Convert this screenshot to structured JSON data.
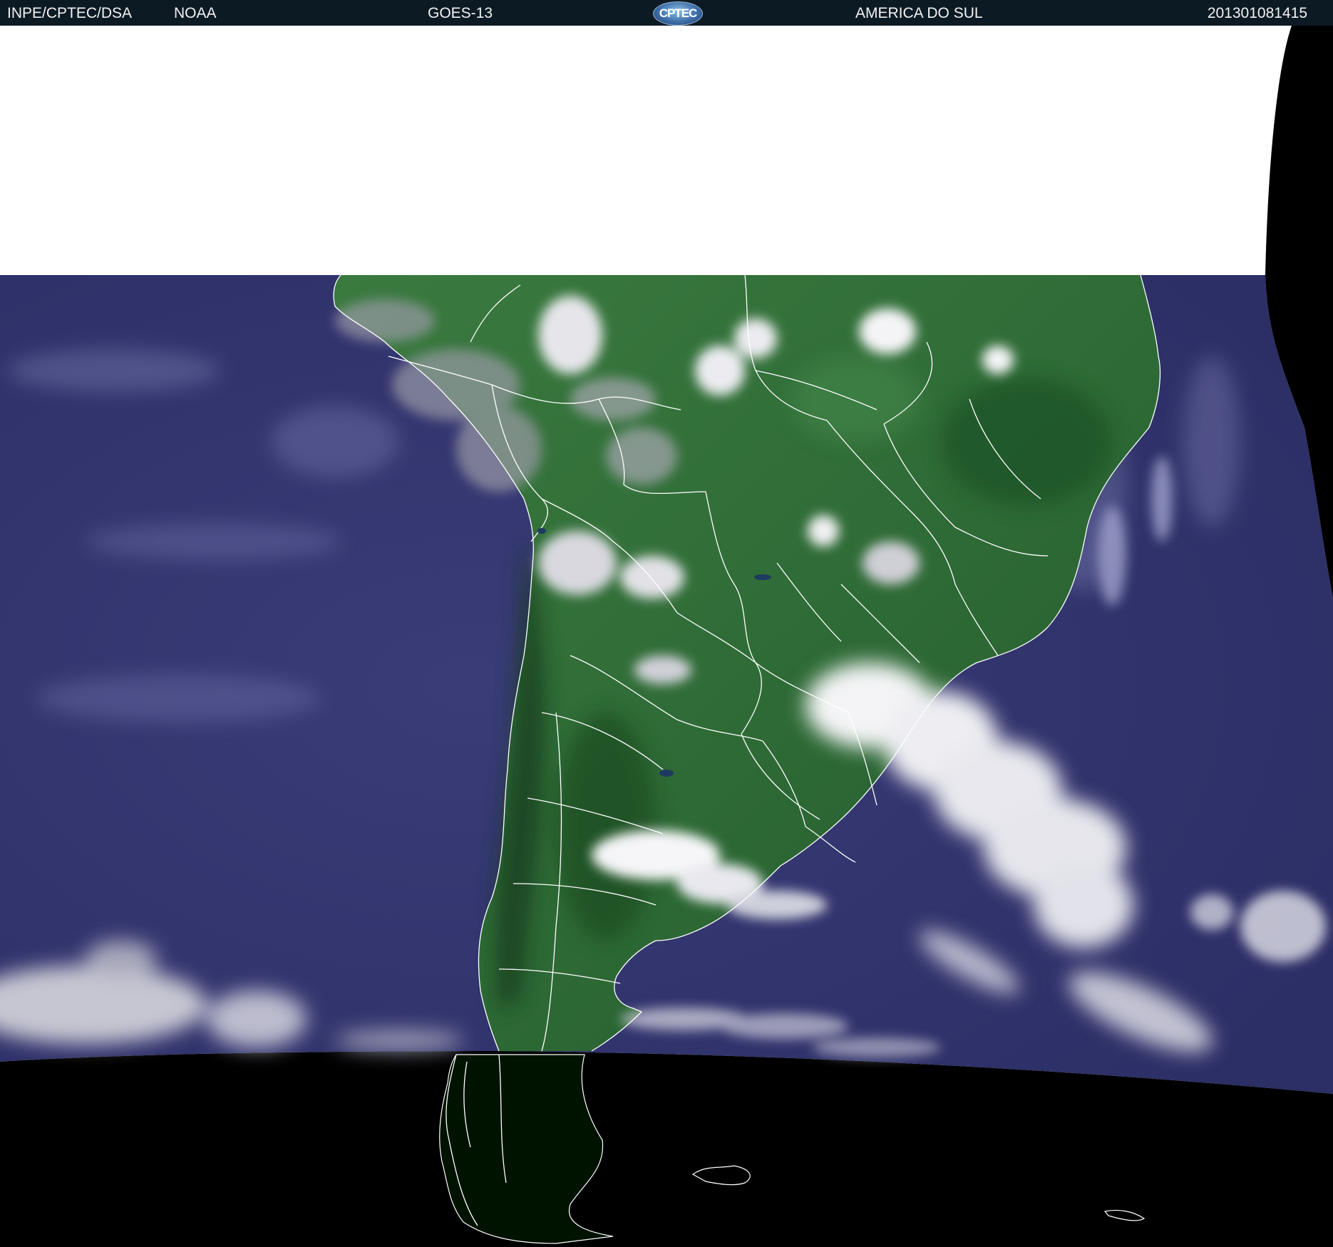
{
  "header": {
    "organization": "INPE/CPTEC/DSA",
    "agency": "NOAA",
    "satellite": "GOES-13",
    "logo_text": "CPTEC",
    "region": "AMERICA DO SUL",
    "timestamp": "201301081415"
  },
  "colors": {
    "header_bg": "#0c1a24",
    "ocean": "#363870",
    "land": "#2f6a35",
    "land_dark": "#1d4a25",
    "cloud": "#f2f2f4",
    "cloud_thin": "#c8c8d8",
    "night": "#000000",
    "border_lines": "#ffffff",
    "no_data": "#ffffff"
  }
}
